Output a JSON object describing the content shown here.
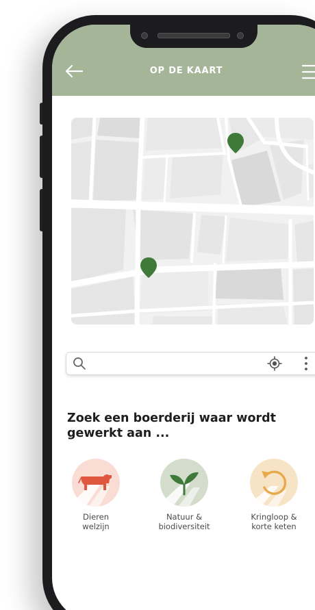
{
  "header": {
    "title": "OP DE KAART",
    "background_color": "#a4b598"
  },
  "map": {
    "marker_color": "#3f7a3a"
  },
  "search": {
    "value": "",
    "placeholder": ""
  },
  "section": {
    "heading": "Zoek een boerderij waar wordt gewerkt aan ..."
  },
  "categories": [
    {
      "label": "Dieren\nwelzijn",
      "icon": "cow-icon",
      "color": "#e0573f",
      "background": "#f9dcd4"
    },
    {
      "label": "Natuur &\nbiodiversiteit",
      "icon": "sprout-icon",
      "color": "#3f7a3a",
      "background": "#d4dccc"
    },
    {
      "label": "Kringloop &\nkorte keten",
      "icon": "cycle-icon",
      "color": "#e8a94a",
      "background": "#f7e4c6"
    }
  ]
}
